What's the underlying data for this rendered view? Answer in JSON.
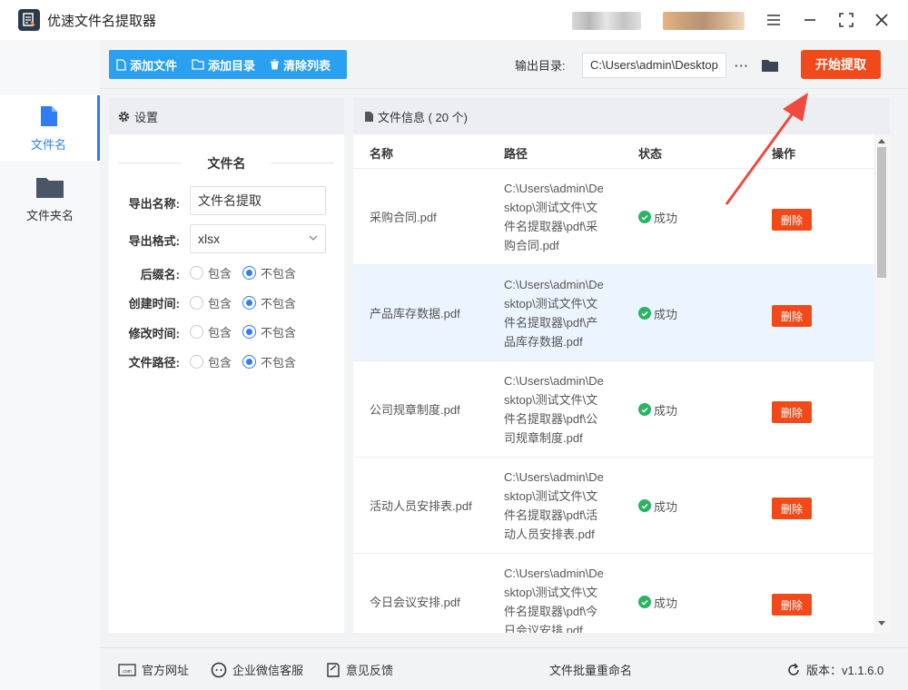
{
  "app": {
    "title": "优速文件名提取器"
  },
  "sidebar": {
    "items": [
      {
        "label": "文件名",
        "icon": "file-icon"
      },
      {
        "label": "文件夹名",
        "icon": "folder-icon"
      }
    ]
  },
  "toolbar": {
    "add_file": "添加文件",
    "add_dir": "添加目录",
    "clear_list": "清除列表",
    "output_label": "输出目录:",
    "output_value": "C:\\Users\\admin\\Desktop",
    "more": "···",
    "start": "开始提取"
  },
  "settings": {
    "header": "设置",
    "section_title": "文件名",
    "export_name_label": "导出名称:",
    "export_name_value": "文件名提取",
    "export_format_label": "导出格式:",
    "export_format_value": "xlsx",
    "options": [
      {
        "label": "后缀名:",
        "include": "包含",
        "exclude": "不包含",
        "selected": "exclude"
      },
      {
        "label": "创建时间:",
        "include": "包含",
        "exclude": "不包含",
        "selected": "exclude"
      },
      {
        "label": "修改时间:",
        "include": "包含",
        "exclude": "不包含",
        "selected": "exclude"
      },
      {
        "label": "文件路径:",
        "include": "包含",
        "exclude": "不包含",
        "selected": "exclude"
      }
    ]
  },
  "files": {
    "header": "文件信息 ( 20 个)",
    "columns": {
      "name": "名称",
      "path": "路径",
      "status": "状态",
      "action": "操作"
    },
    "rows": [
      {
        "name": "采购合同.pdf",
        "path": "C:\\Users\\admin\\Desktop\\测试文件\\文件名提取器\\pdf\\采购合同.pdf",
        "status": "成功",
        "action": "删除"
      },
      {
        "name": "产品库存数据.pdf",
        "path": "C:\\Users\\admin\\Desktop\\测试文件\\文件名提取器\\pdf\\产品库存数据.pdf",
        "status": "成功",
        "action": "删除"
      },
      {
        "name": "公司规章制度.pdf",
        "path": "C:\\Users\\admin\\Desktop\\测试文件\\文件名提取器\\pdf\\公司规章制度.pdf",
        "status": "成功",
        "action": "删除"
      },
      {
        "name": "活动人员安排表.pdf",
        "path": "C:\\Users\\admin\\Desktop\\测试文件\\文件名提取器\\pdf\\活动人员安排表.pdf",
        "status": "成功",
        "action": "删除"
      },
      {
        "name": "今日会议安排.pdf",
        "path": "C:\\Users\\admin\\Desktop\\测试文件\\文件名提取器\\pdf\\今日会议安排.pdf",
        "status": "成功",
        "action": "删除"
      }
    ]
  },
  "footer": {
    "website": "官方网址",
    "wechat": "企业微信客服",
    "feedback": "意见反馈",
    "rename": "文件批量重命名",
    "version": "版本：v1.1.6.0"
  },
  "colors": {
    "accent": "#2f7df6",
    "toolbar_blue": "#29a0f0",
    "primary_red": "#f04a1a",
    "success_green": "#28b463"
  }
}
